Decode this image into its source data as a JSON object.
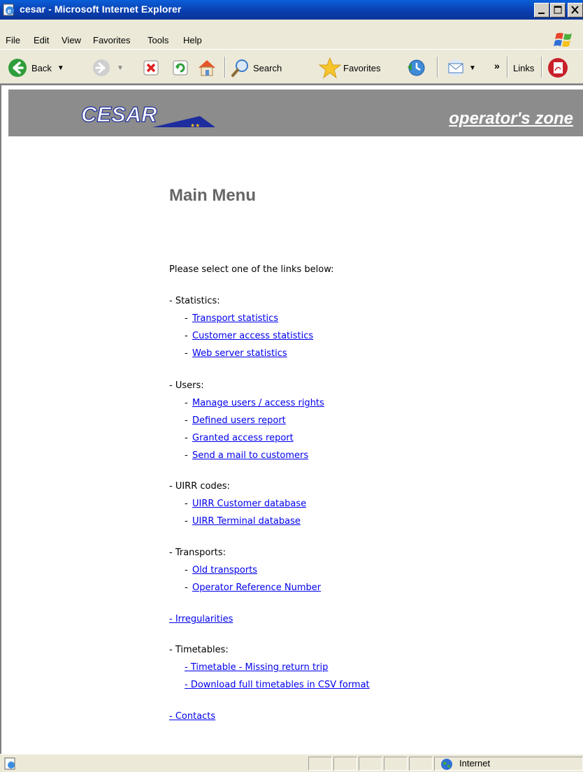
{
  "window": {
    "title": "cesar - Microsoft Internet Explorer",
    "buttons": [
      "minimize",
      "maximize",
      "close"
    ]
  },
  "menu": [
    "File",
    "Edit",
    "View",
    "Favorites",
    "Tools",
    "Help"
  ],
  "toolbar": {
    "back": "Back",
    "search": "Search",
    "favorites": "Favorites",
    "chevron": "»",
    "links": "Links"
  },
  "banner": {
    "logo": "CESAR",
    "zone": "operator's zone"
  },
  "page": {
    "title": "Main Menu",
    "intro": "Please select one of the links below:",
    "sections": {
      "statistics": {
        "label": "- Statistics:",
        "links": [
          "Transport statistics",
          "Customer access statistics",
          "Web server statistics"
        ]
      },
      "users": {
        "label": "- Users:",
        "links": [
          "Manage users / access rights",
          "Defined users report",
          "Granted access report",
          "Send a mail to customers"
        ]
      },
      "uirr": {
        "label": "- UIRR codes:",
        "links": [
          "UIRR Customer database",
          "UIRR Terminal database"
        ]
      },
      "transports": {
        "label": "- Transports:",
        "links": [
          "Old transports",
          "Operator Reference Number"
        ]
      },
      "irregularities": "- Irregularities",
      "timetables": {
        "label": "- Timetables:",
        "links": [
          "- Timetable - Missing return trip",
          "- Download full timetables in CSV format"
        ]
      },
      "contacts": "- Contacts"
    }
  },
  "status": {
    "zone": "Internet"
  }
}
